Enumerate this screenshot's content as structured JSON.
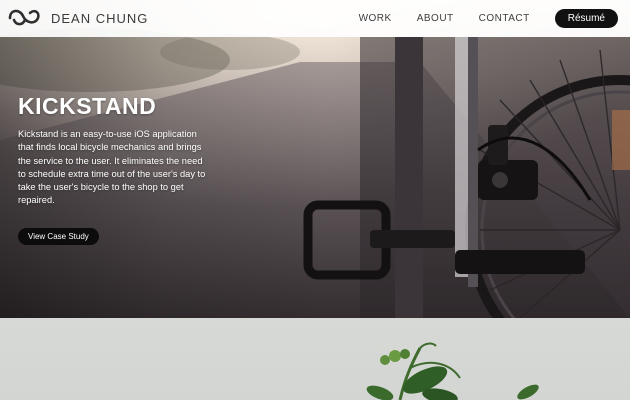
{
  "nav": {
    "brand": "DEAN CHUNG",
    "links": [
      "WORK",
      "ABOUT",
      "CONTACT"
    ],
    "resume_label": "Résumé"
  },
  "hero": {
    "title": "KICKSTAND",
    "description": "Kickstand is an easy-to-use iOS application that finds local bicycle mechanics and brings the service to the user. It eliminates the need to schedule extra time out of the user's day to take the user's bicycle to the shop to get repaired.",
    "cta_label": "View Case Study"
  },
  "icons": {
    "logo": "wave-logo-icon",
    "hero_image": "bicycle-wheel-photo",
    "section_image": "plant-sprig-photo"
  },
  "colors": {
    "nav_bg": "#ffffff",
    "button_bg": "#111111",
    "button_text": "#ffffff"
  }
}
